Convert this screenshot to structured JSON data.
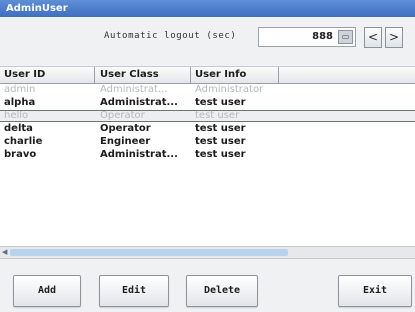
{
  "window": {
    "title": "AdminUser"
  },
  "logout": {
    "label": "Automatic logout (sec)",
    "value": "888",
    "spin": "▭"
  },
  "nav": {
    "prev": "<",
    "next": ">"
  },
  "table": {
    "columns": [
      "User ID",
      "User Class",
      "User Info"
    ],
    "rows": [
      {
        "id": "admin",
        "cls": "Administrat...",
        "info": "Administrator",
        "state": "disabled"
      },
      {
        "id": "alpha",
        "cls": "Administrat...",
        "info": "test user",
        "state": "normal"
      },
      {
        "id": "hello",
        "cls": "Operator",
        "info": "test user",
        "state": "selected"
      },
      {
        "id": "delta",
        "cls": "Operator",
        "info": "test user",
        "state": "normal"
      },
      {
        "id": "charlie",
        "cls": "Engineer",
        "info": "test user",
        "state": "normal"
      },
      {
        "id": "bravo",
        "cls": "Administrat...",
        "info": "test user",
        "state": "normal"
      }
    ]
  },
  "buttons": {
    "add": "Add",
    "edit": "Edit",
    "delete": "Delete",
    "exit": "Exit"
  },
  "scroll": {
    "left_arrow": "◀"
  }
}
